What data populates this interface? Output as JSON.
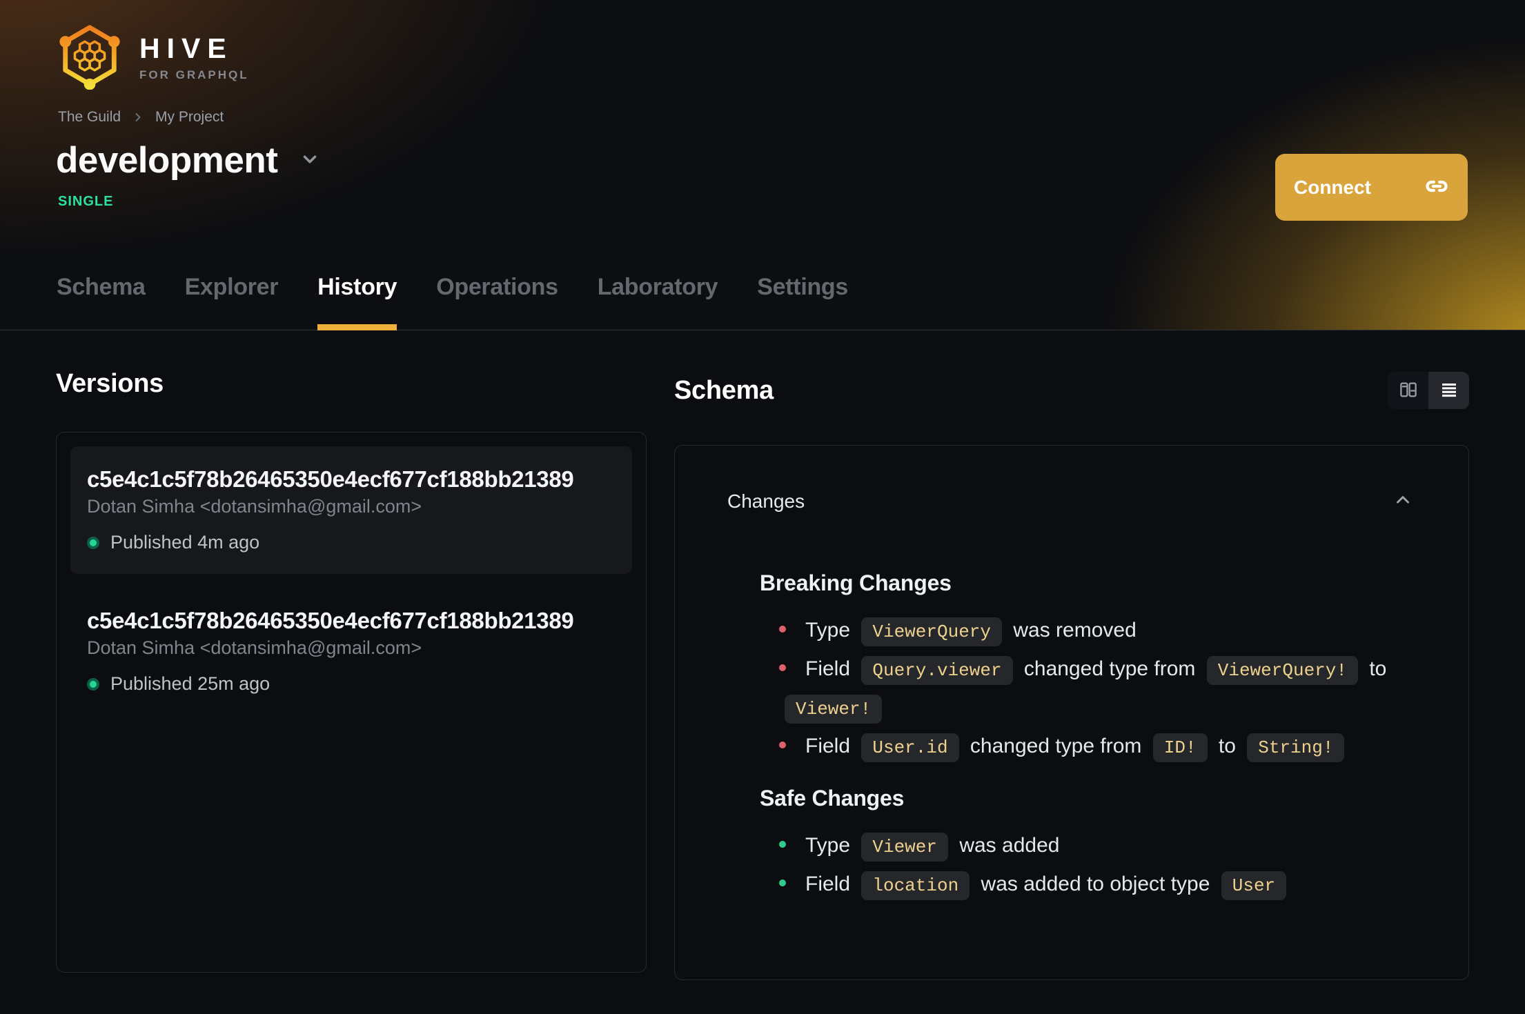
{
  "brand": {
    "name": "HIVE",
    "tagline": "FOR GRAPHQL"
  },
  "breadcrumb": {
    "org": "The Guild",
    "project": "My Project"
  },
  "target": {
    "name": "development",
    "badge": "SINGLE"
  },
  "actions": {
    "connect_label": "Connect"
  },
  "tabs": [
    {
      "label": "Schema",
      "active": false
    },
    {
      "label": "Explorer",
      "active": false
    },
    {
      "label": "History",
      "active": true
    },
    {
      "label": "Operations",
      "active": false
    },
    {
      "label": "Laboratory",
      "active": false
    },
    {
      "label": "Settings",
      "active": false
    }
  ],
  "versions": {
    "title": "Versions",
    "items": [
      {
        "hash": "c5e4c1c5f78b26465350e4ecf677cf188bb21389",
        "author": "Dotan Simha <dotansimha@gmail.com>",
        "status": "Published 4m ago",
        "selected": true
      },
      {
        "hash": "c5e4c1c5f78b26465350e4ecf677cf188bb21389",
        "author": "Dotan Simha <dotansimha@gmail.com>",
        "status": "Published 25m ago",
        "selected": false
      }
    ]
  },
  "schema_panel": {
    "title": "Schema",
    "view_modes": [
      {
        "name": "columns-view",
        "active": false
      },
      {
        "name": "list-view",
        "active": true
      }
    ],
    "changes": {
      "title": "Changes",
      "sections": [
        {
          "title": "Breaking Changes",
          "kind": "breaking",
          "items": [
            [
              {
                "text": "Type "
              },
              {
                "code": "ViewerQuery"
              },
              {
                "text": " was removed"
              }
            ],
            [
              {
                "text": "Field "
              },
              {
                "code": "Query.viewer"
              },
              {
                "text": " changed type from "
              },
              {
                "code": "ViewerQuery!"
              },
              {
                "text": " to "
              },
              {
                "code": "Viewer!"
              }
            ],
            [
              {
                "text": "Field "
              },
              {
                "code": "User.id"
              },
              {
                "text": " changed type from "
              },
              {
                "code": "ID!"
              },
              {
                "text": " to "
              },
              {
                "code": "String!"
              }
            ]
          ]
        },
        {
          "title": "Safe Changes",
          "kind": "safe",
          "items": [
            [
              {
                "text": "Type "
              },
              {
                "code": "Viewer"
              },
              {
                "text": " was added"
              }
            ],
            [
              {
                "text": "Field "
              },
              {
                "code": "location"
              },
              {
                "text": " was added to object type "
              },
              {
                "code": "User"
              }
            ]
          ]
        }
      ]
    }
  },
  "colors": {
    "accent_amber": "#efaf3d",
    "connect_bg": "#d9a43c",
    "badge_green": "#2de0a0",
    "breaking_bullet": "#e0606d",
    "safe_bullet": "#2ccb8e",
    "chip_text": "#edd28e",
    "chip_bg": "#26272b",
    "published_dot": "#25d694"
  }
}
